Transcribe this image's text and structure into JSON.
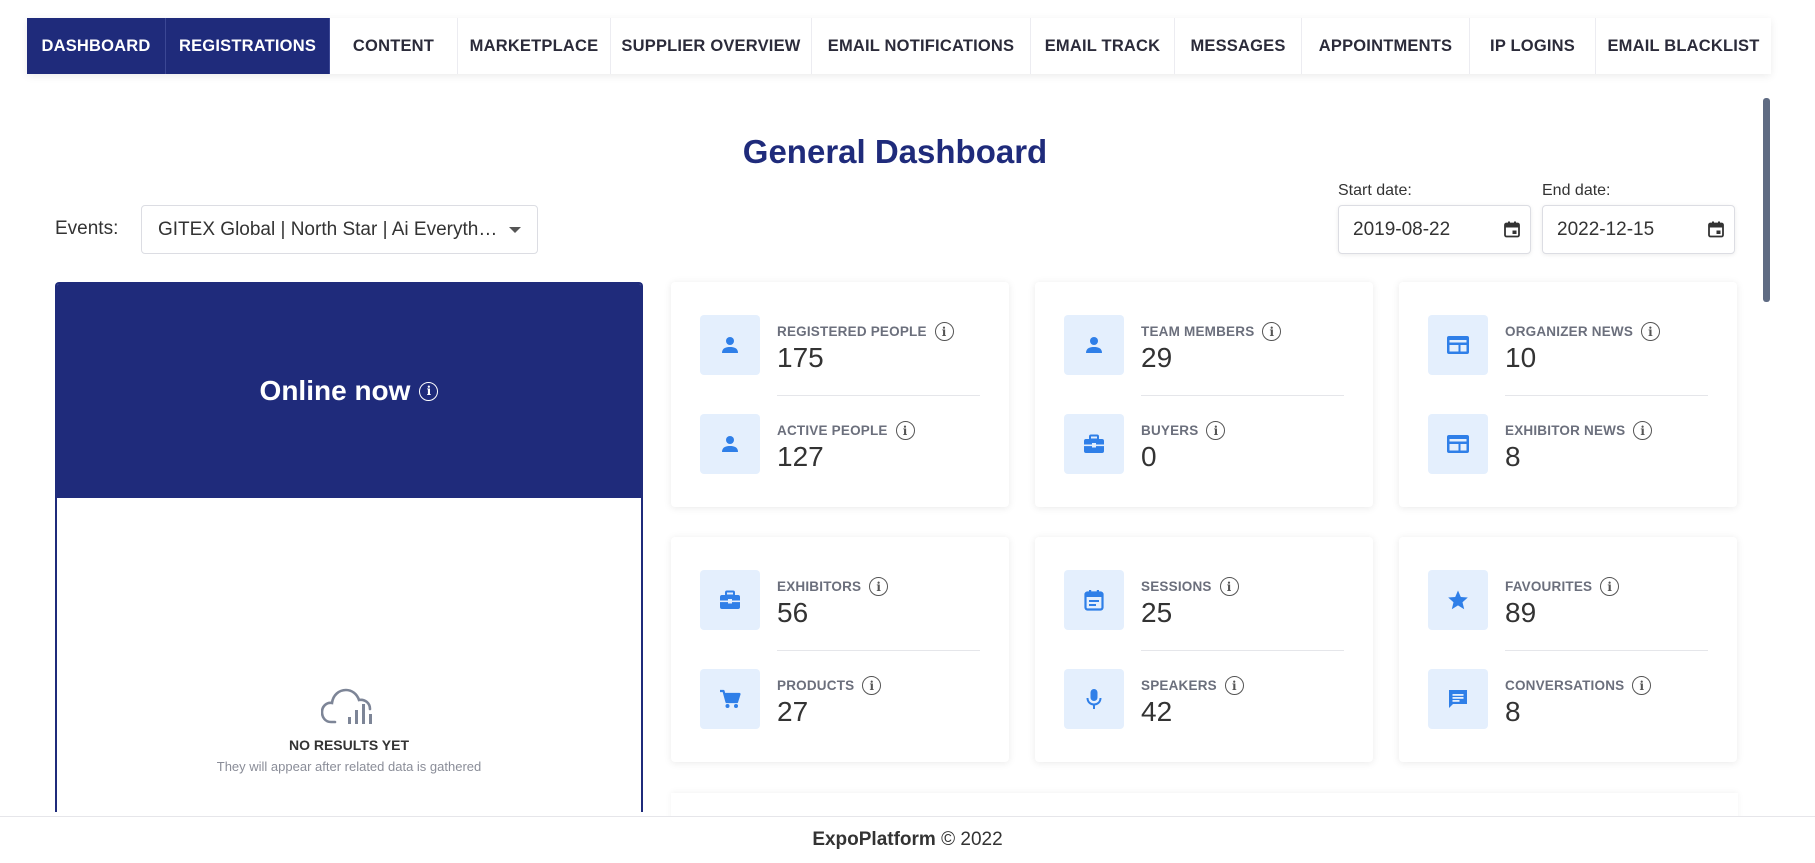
{
  "nav": {
    "tabs": [
      {
        "label": "DASHBOARD",
        "active": true
      },
      {
        "label": "REGISTRATIONS",
        "active": true
      },
      {
        "label": "CONTENT",
        "active": false
      },
      {
        "label": "MARKETPLACE",
        "active": false
      },
      {
        "label": "SUPPLIER OVERVIEW",
        "active": false
      },
      {
        "label": "EMAIL NOTIFICATIONS",
        "active": false
      },
      {
        "label": "EMAIL TRACK",
        "active": false
      },
      {
        "label": "MESSAGES",
        "active": false
      },
      {
        "label": "APPOINTMENTS",
        "active": false
      },
      {
        "label": "IP LOGINS",
        "active": false
      },
      {
        "label": "EMAIL BLACKLIST",
        "active": false
      }
    ]
  },
  "page": {
    "title": "General Dashboard"
  },
  "filters": {
    "events_label": "Events:",
    "events_value": "GITEX Global | North Star | Ai Everything | ...",
    "start_label": "Start date:",
    "start_value": "2019-08-22",
    "end_label": "End date:",
    "end_value": "2022-12-15"
  },
  "online": {
    "title": "Online now",
    "empty_title": "NO RESULTS YET",
    "empty_subtitle": "They will appear after related data is gathered"
  },
  "cards": [
    {
      "stats": [
        {
          "label": "REGISTERED PEOPLE",
          "value": "175",
          "icon": "person-icon"
        },
        {
          "label": "ACTIVE PEOPLE",
          "value": "127",
          "icon": "person-icon"
        }
      ]
    },
    {
      "stats": [
        {
          "label": "TEAM MEMBERS",
          "value": "29",
          "icon": "person-icon"
        },
        {
          "label": "BUYERS",
          "value": "0",
          "icon": "briefcase-icon"
        }
      ]
    },
    {
      "stats": [
        {
          "label": "ORGANIZER NEWS",
          "value": "10",
          "icon": "news-icon"
        },
        {
          "label": "EXHIBITOR NEWS",
          "value": "8",
          "icon": "news-icon"
        }
      ]
    },
    {
      "stats": [
        {
          "label": "EXHIBITORS",
          "value": "56",
          "icon": "briefcase-icon"
        },
        {
          "label": "PRODUCTS",
          "value": "27",
          "icon": "cart-icon"
        }
      ]
    },
    {
      "stats": [
        {
          "label": "SESSIONS",
          "value": "25",
          "icon": "calendar-icon"
        },
        {
          "label": "SPEAKERS",
          "value": "42",
          "icon": "microphone-icon"
        }
      ]
    },
    {
      "stats": [
        {
          "label": "FAVOURITES",
          "value": "89",
          "icon": "star-icon"
        },
        {
          "label": "CONVERSATIONS",
          "value": "8",
          "icon": "chat-icon"
        }
      ]
    }
  ],
  "footer": {
    "brand": "ExpoPlatform",
    "copyright": "© 2022"
  },
  "colors": {
    "primary": "#1f2b7b",
    "icon_blue": "#2f7fe8",
    "icon_bg": "#e4effd"
  }
}
